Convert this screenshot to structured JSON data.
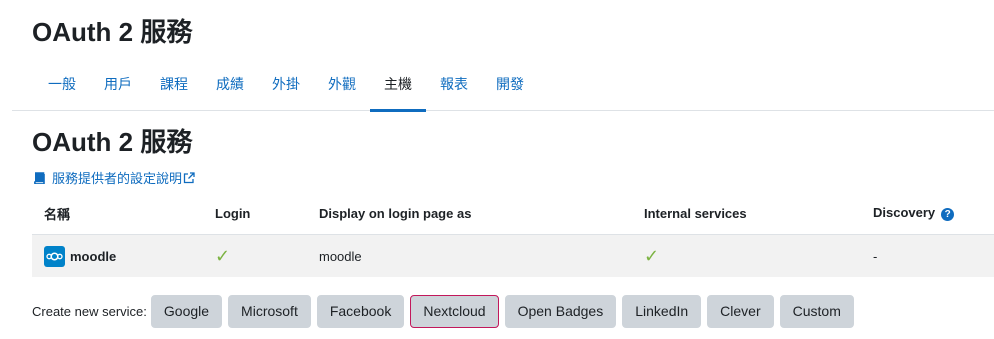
{
  "page_title": "OAuth 2 服務",
  "tabs": [
    {
      "label": "一般"
    },
    {
      "label": "用戶"
    },
    {
      "label": "課程"
    },
    {
      "label": "成績"
    },
    {
      "label": "外掛"
    },
    {
      "label": "外觀"
    },
    {
      "label": "主機",
      "active": true
    },
    {
      "label": "報表"
    },
    {
      "label": "開發"
    }
  ],
  "section_title": "OAuth 2 服務",
  "help_link": {
    "label": "服務提供者的設定說明",
    "icon": "book-icon",
    "external_icon": "external-link-icon"
  },
  "table": {
    "headers": {
      "name": "名稱",
      "login": "Login",
      "display": "Display on login page as",
      "internal": "Internal services",
      "discovery": "Discovery"
    },
    "rows": [
      {
        "name": "moodle",
        "logo": "nextcloud-logo-icon",
        "login_icon": "check-icon",
        "display": "moodle",
        "internal_icon": "check-icon",
        "discovery": "-"
      }
    ]
  },
  "create": {
    "label": "Create new service:",
    "buttons": [
      {
        "label": "Google"
      },
      {
        "label": "Microsoft"
      },
      {
        "label": "Facebook"
      },
      {
        "label": "Nextcloud",
        "focused": true
      },
      {
        "label": "Open Badges"
      },
      {
        "label": "LinkedIn"
      },
      {
        "label": "Clever"
      },
      {
        "label": "Custom"
      }
    ]
  },
  "colors": {
    "link": "#0f6cbf",
    "check": "#7cb342",
    "focus": "#c2185b",
    "button": "#ced4da"
  }
}
